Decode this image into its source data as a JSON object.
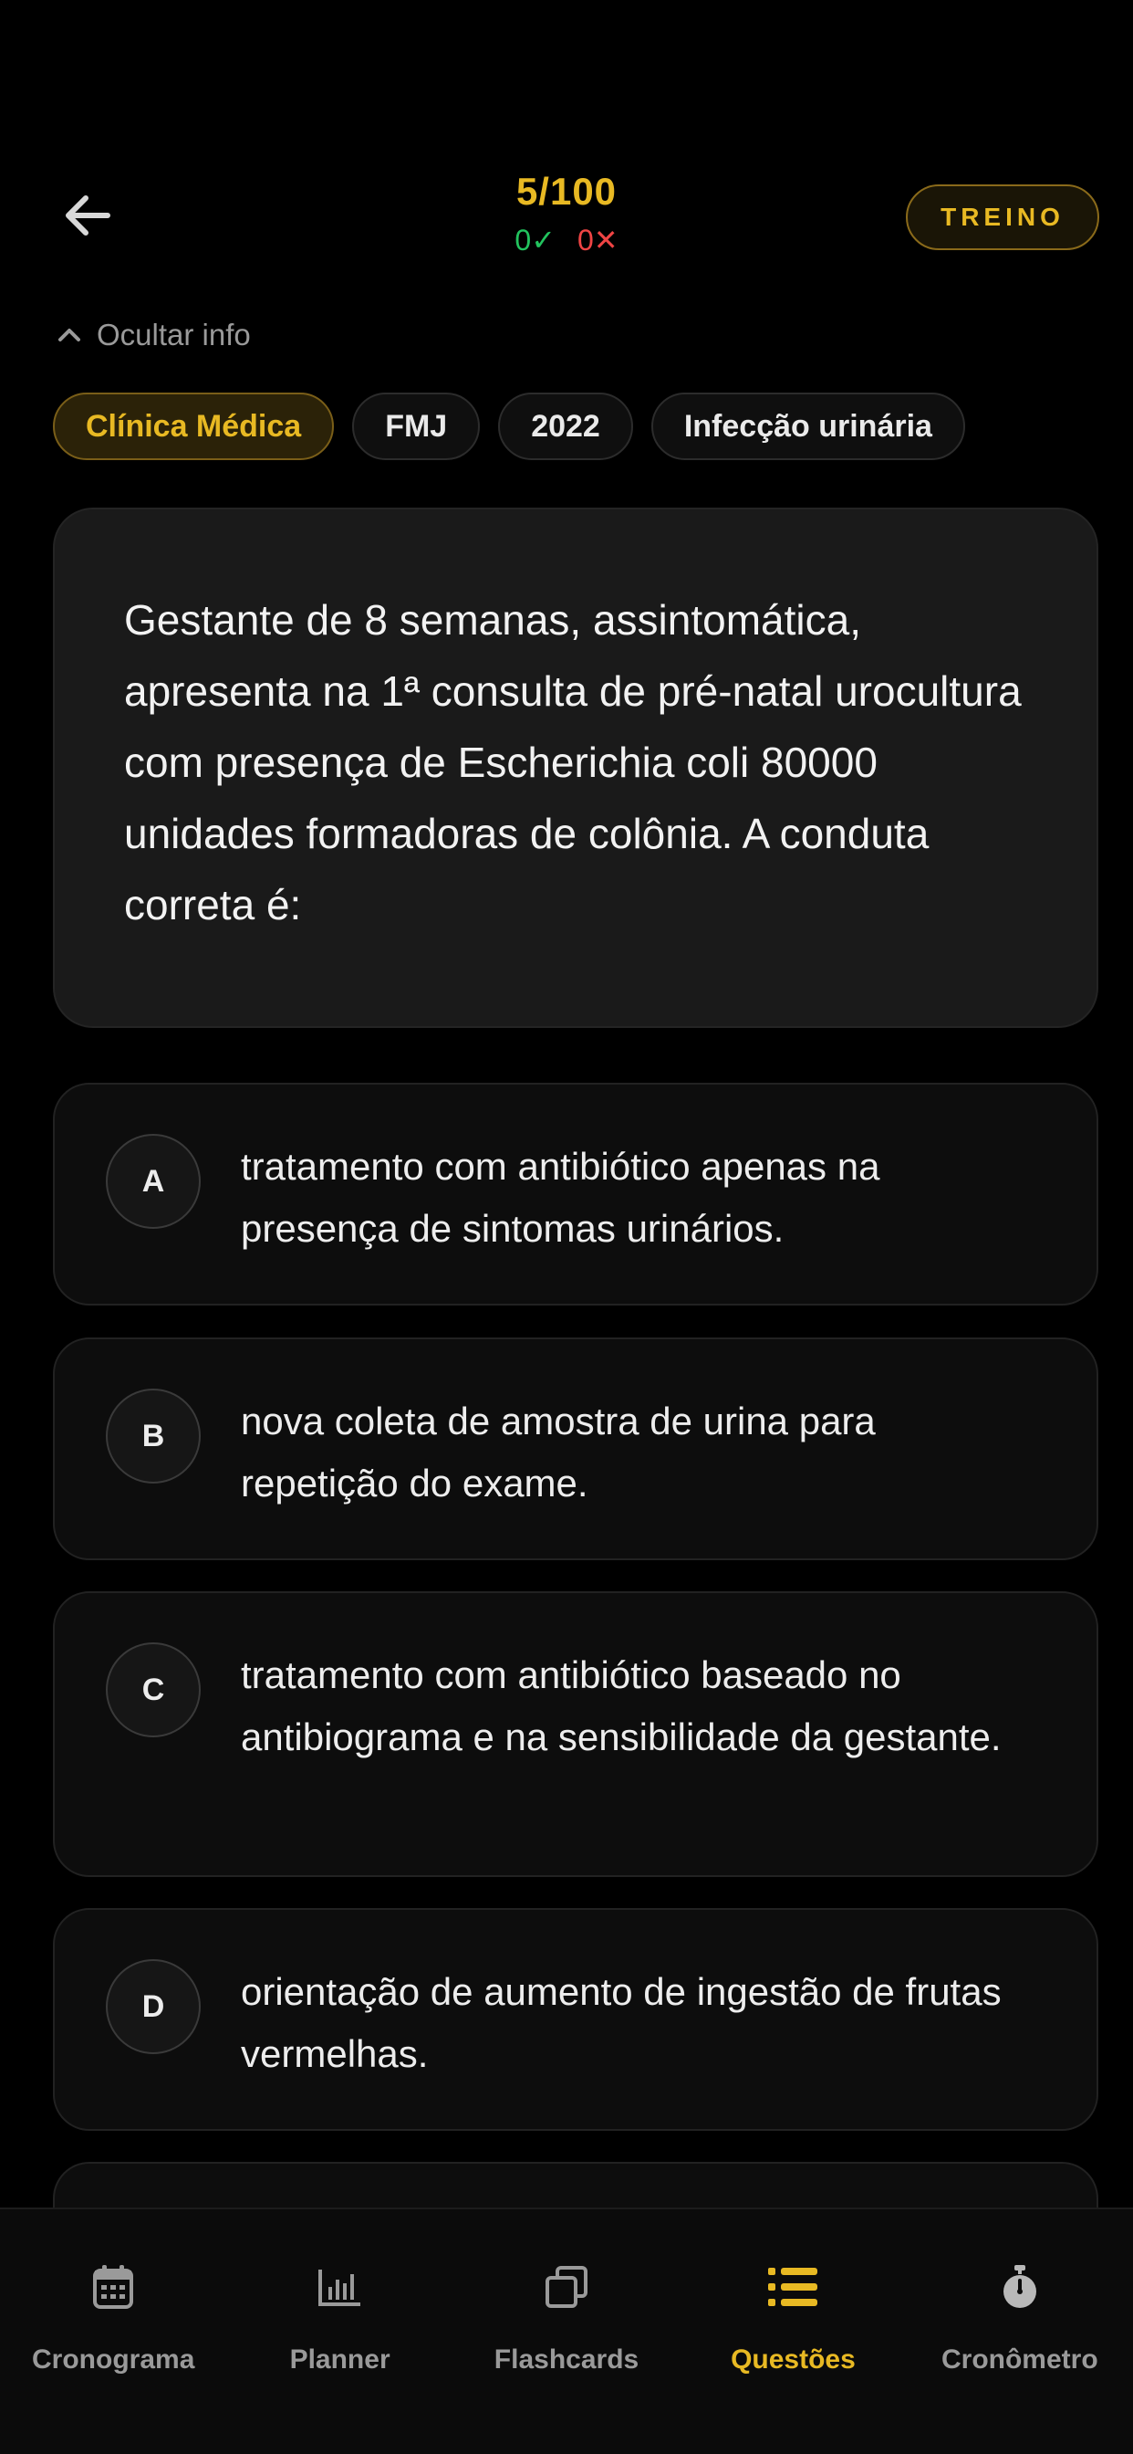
{
  "header": {
    "progress": "5/100",
    "correct": "0✓",
    "wrong": "0✕",
    "mode": "TREINO"
  },
  "info_toggle": {
    "label": "Ocultar info"
  },
  "tags": [
    {
      "label": "Clínica Médica",
      "active": true
    },
    {
      "label": "FMJ"
    },
    {
      "label": "2022"
    },
    {
      "label": "Infecção urinária"
    }
  ],
  "question": {
    "text": "Gestante de 8 semanas, assintomática, apresenta na 1ª consulta de pré-natal urocultura com presença de Escherichia coli 80000 unidades formadoras de colônia. A conduta correta é:"
  },
  "options": [
    {
      "letter": "A",
      "text": "tratamento com antibiótico apenas na presença de sintomas urinários."
    },
    {
      "letter": "B",
      "text": "nova coleta de amostra de urina para repetição do exame."
    },
    {
      "letter": "C",
      "text": "tratamento com antibiótico baseado no antibiograma e na sensibilidade da gestante."
    },
    {
      "letter": "D",
      "text": "orientação de aumento de ingestão de frutas vermelhas."
    }
  ],
  "nav": [
    {
      "label": "Cronograma",
      "icon": "calendar-icon"
    },
    {
      "label": "Planner",
      "icon": "bar-chart-icon"
    },
    {
      "label": "Flashcards",
      "icon": "cards-icon"
    },
    {
      "label": "Questões",
      "icon": "list-icon",
      "active": true
    },
    {
      "label": "Cronômetro",
      "icon": "stopwatch-icon"
    }
  ],
  "colors": {
    "accent": "#E8B923",
    "correct": "#22C35E",
    "wrong": "#EF4444",
    "background": "#000000"
  }
}
